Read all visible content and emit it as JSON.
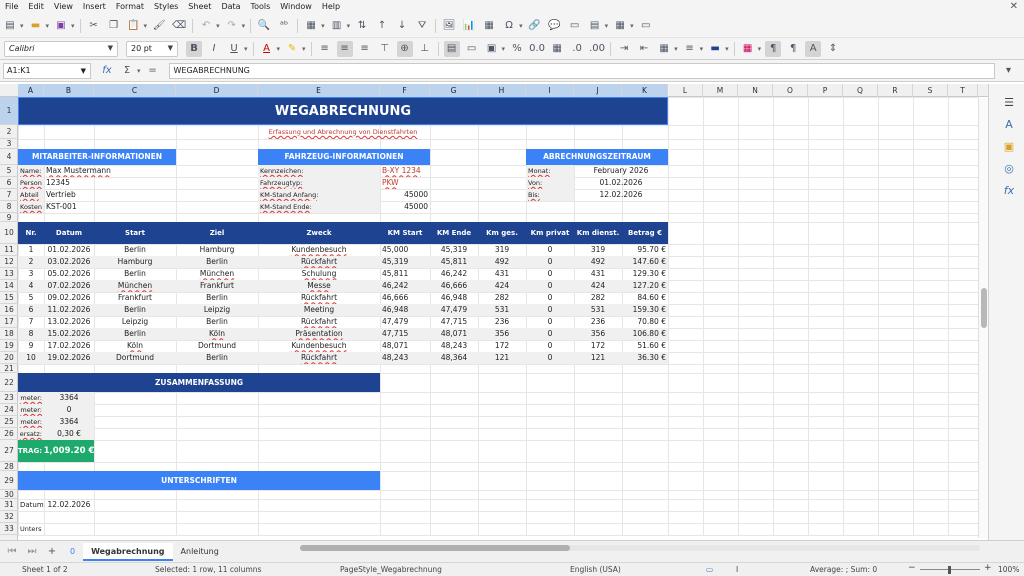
{
  "menu": [
    "File",
    "Edit",
    "View",
    "Insert",
    "Format",
    "Styles",
    "Sheet",
    "Data",
    "Tools",
    "Window",
    "Help"
  ],
  "toolbar": {
    "font_name": "Calibri",
    "font_size": "20 pt"
  },
  "formula_bar": {
    "name_box": "A1:K1",
    "formula": "WEGABRECHNUNG"
  },
  "columns": [
    "A",
    "B",
    "C",
    "D",
    "E",
    "F",
    "G",
    "H",
    "I",
    "J",
    "K",
    "L",
    "M",
    "N",
    "O",
    "P",
    "Q",
    "R",
    "S",
    "T"
  ],
  "rows": [
    "1",
    "2",
    "3",
    "4",
    "5",
    "6",
    "7",
    "8",
    "9",
    "10",
    "11",
    "12",
    "13",
    "14",
    "15",
    "16",
    "17",
    "18",
    "19",
    "20",
    "21",
    "22",
    "23",
    "24",
    "25",
    "26",
    "27",
    "28",
    "29",
    "30",
    "31",
    "32",
    "33"
  ],
  "sheet": {
    "title": "WEGABRECHNUNG",
    "subtitle": "Erfassung und Abrechnung von Dienstfahrten",
    "section_employee": "MITARBEITER-INFORMATIONEN",
    "section_vehicle": "FAHRZEUG-INFORMATIONEN",
    "section_period": "ABRECHNUNGSZEITRAUM",
    "emp_name_label": "Name:",
    "emp_name": "Max Mustermann",
    "emp_pers_label": "Person",
    "emp_pers": "12345",
    "emp_dept_label": "Abteil",
    "emp_dept": "Vertrieb",
    "emp_cost_label": "Kosten",
    "emp_cost": "KST-001",
    "veh_plate_label": "Kennzeichen:",
    "veh_plate": "B-XY 1234",
    "veh_type_label": "Fahrzeugtyp:",
    "veh_type": "PKW",
    "veh_km_start_label": "KM-Stand Anfang:",
    "veh_km_start": "45000",
    "veh_km_end_label": "KM-Stand Ende:",
    "veh_km_end": "45000",
    "per_month_label": "Monat:",
    "per_month": "February 2026",
    "per_from_label": "Von:",
    "per_from": "01.02.2026",
    "per_to_label": "Bis:",
    "per_to": "12.02.2026",
    "table_headers": [
      "Nr.",
      "Datum",
      "Start",
      "Ziel",
      "Zweck",
      "KM Start",
      "KM Ende",
      "Km ges.",
      "Km privat",
      "Km dienst.",
      "Betrag €"
    ],
    "table_rows": [
      [
        "1",
        "01.02.2026",
        "Berlin",
        "Hamburg",
        "Kundenbesuch",
        "45,000",
        "45,319",
        "319",
        "0",
        "319",
        "95.70 €"
      ],
      [
        "2",
        "03.02.2026",
        "Hamburg",
        "Berlin",
        "Rückfahrt",
        "45,319",
        "45,811",
        "492",
        "0",
        "492",
        "147.60 €"
      ],
      [
        "3",
        "05.02.2026",
        "Berlin",
        "München",
        "Schulung",
        "45,811",
        "46,242",
        "431",
        "0",
        "431",
        "129.30 €"
      ],
      [
        "4",
        "07.02.2026",
        "München",
        "Frankfurt",
        "Messe",
        "46,242",
        "46,666",
        "424",
        "0",
        "424",
        "127.20 €"
      ],
      [
        "5",
        "09.02.2026",
        "Frankfurt",
        "Berlin",
        "Rückfahrt",
        "46,666",
        "46,948",
        "282",
        "0",
        "282",
        "84.60 €"
      ],
      [
        "6",
        "11.02.2026",
        "Berlin",
        "Leipzig",
        "Meeting",
        "46,948",
        "47,479",
        "531",
        "0",
        "531",
        "159.30 €"
      ],
      [
        "7",
        "13.02.2026",
        "Leipzig",
        "Berlin",
        "Rückfahrt",
        "47,479",
        "47,715",
        "236",
        "0",
        "236",
        "70.80 €"
      ],
      [
        "8",
        "15.02.2026",
        "Berlin",
        "Köln",
        "Präsentation",
        "47,715",
        "48,071",
        "356",
        "0",
        "356",
        "106.80 €"
      ],
      [
        "9",
        "17.02.2026",
        "Köln",
        "Dortmund",
        "Kundenbesuch",
        "48,071",
        "48,243",
        "172",
        "0",
        "172",
        "51.60 €"
      ],
      [
        "10",
        "19.02.2026",
        "Dortmund",
        "Berlin",
        "Rückfahrt",
        "48,243",
        "48,364",
        "121",
        "0",
        "121",
        "36.30 €"
      ]
    ],
    "section_summary": "ZUSAMMENFASSUNG",
    "summary_rows": [
      {
        "label": "meter:",
        "value": "3364"
      },
      {
        "label": "meter:",
        "value": "0"
      },
      {
        "label": "meter:",
        "value": "3364"
      },
      {
        "label": "ersatz:",
        "value": "0,30 €"
      }
    ],
    "total_label": "TRAG:",
    "total_value": "1,009.20 €",
    "section_signatures": "UNTERSCHRIFTEN",
    "sig_date_label": "Datum:",
    "sig_date": "12.02.2026",
    "sig_sign_label": "Unters"
  },
  "tabs": {
    "add": "+",
    "num": "0",
    "tab1": "Wegabrechnung",
    "tab2": "Anleitung"
  },
  "status": {
    "sheet": "Sheet 1 of 2",
    "selection": "Selected: 1 row, 11 columns",
    "page_style": "PageStyle_Wegabrechnung",
    "language": "English (USA)",
    "sum": "Average: ; Sum: 0",
    "zoom": "100%"
  },
  "colors": {
    "dark_blue": "#1e4391",
    "light_blue": "#3b82f6",
    "green": "#1faa6d"
  }
}
